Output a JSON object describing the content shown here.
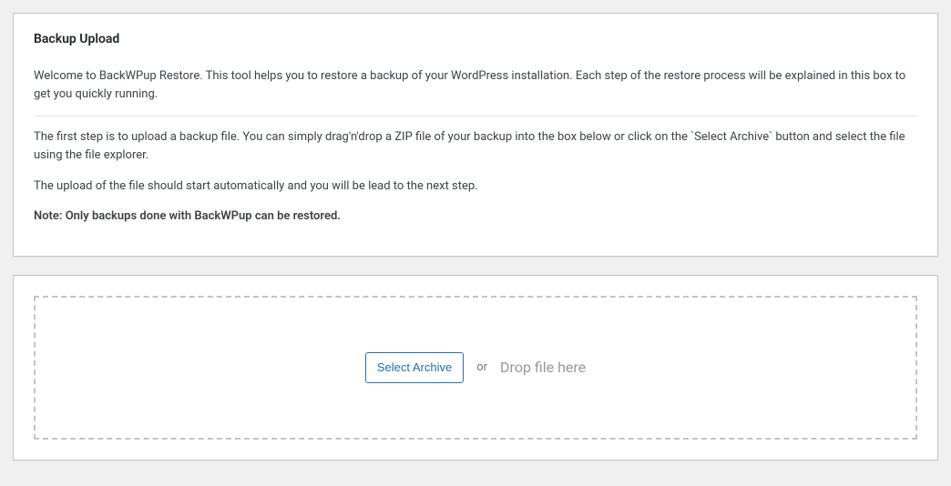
{
  "infoPanel": {
    "title": "Backup Upload",
    "intro": "Welcome to BackWPup Restore. This tool helps you to restore a backup of your WordPress installation. Each step of the restore process will be explained in this box to get you quickly running.",
    "step1": "The first step is to upload a backup file. You can simply drag'n'drop a ZIP file of your backup into the box below or click on the `Select Archive` button and select the file using the file explorer.",
    "uploadInfo": "The upload of the file should start automatically and you will be lead to the next step.",
    "note": "Note: Only backups done with BackWPup can be restored."
  },
  "uploadPanel": {
    "selectButton": "Select Archive",
    "orText": "or",
    "dropText": "Drop file here"
  }
}
